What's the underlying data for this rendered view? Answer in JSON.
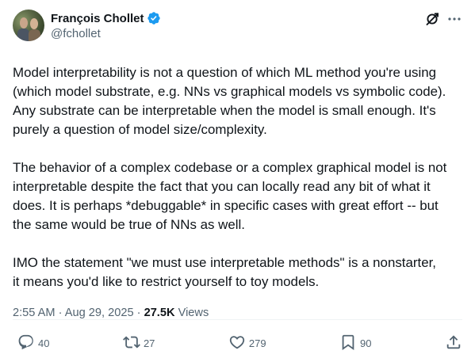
{
  "author": {
    "display_name": "François Chollet",
    "handle": "@fchollet"
  },
  "tweet": {
    "paragraphs": [
      "Model interpretability is not a question of which ML method you're using\n(which model substrate, e.g. NNs vs graphical models vs symbolic code).\nAny substrate can be interpretable when the model is small enough. It's\npurely a question of model size/complexity.",
      "The behavior of a complex codebase or a complex graphical model is not\ninterpretable despite the fact that you can locally read any bit of what it\ndoes. It is perhaps *debuggable* in specific cases with great effort -- but\nthe same would be true of NNs as well.",
      "IMO the statement \"we must use interpretable methods\" is a nonstarter,\nit means you'd like to restrict yourself to toy models."
    ],
    "time": "2:55 AM",
    "separator": "·",
    "date": "Aug 29, 2025",
    "views_count": "27.5K",
    "views_label": "Views"
  },
  "actions": {
    "replies": "40",
    "reposts": "27",
    "likes": "279",
    "bookmarks": "90"
  },
  "icons": {
    "verified": "verified-badge-icon",
    "grok": "grok-icon",
    "more": "more-dots-icon",
    "reply": "reply-icon",
    "repost": "repost-icon",
    "like": "heart-icon",
    "bookmark": "bookmark-icon",
    "share": "share-icon"
  },
  "colors": {
    "text": "#0f1419",
    "secondary": "#536471",
    "verified_blue": "#1d9bf0",
    "divider": "#eff3f4"
  }
}
